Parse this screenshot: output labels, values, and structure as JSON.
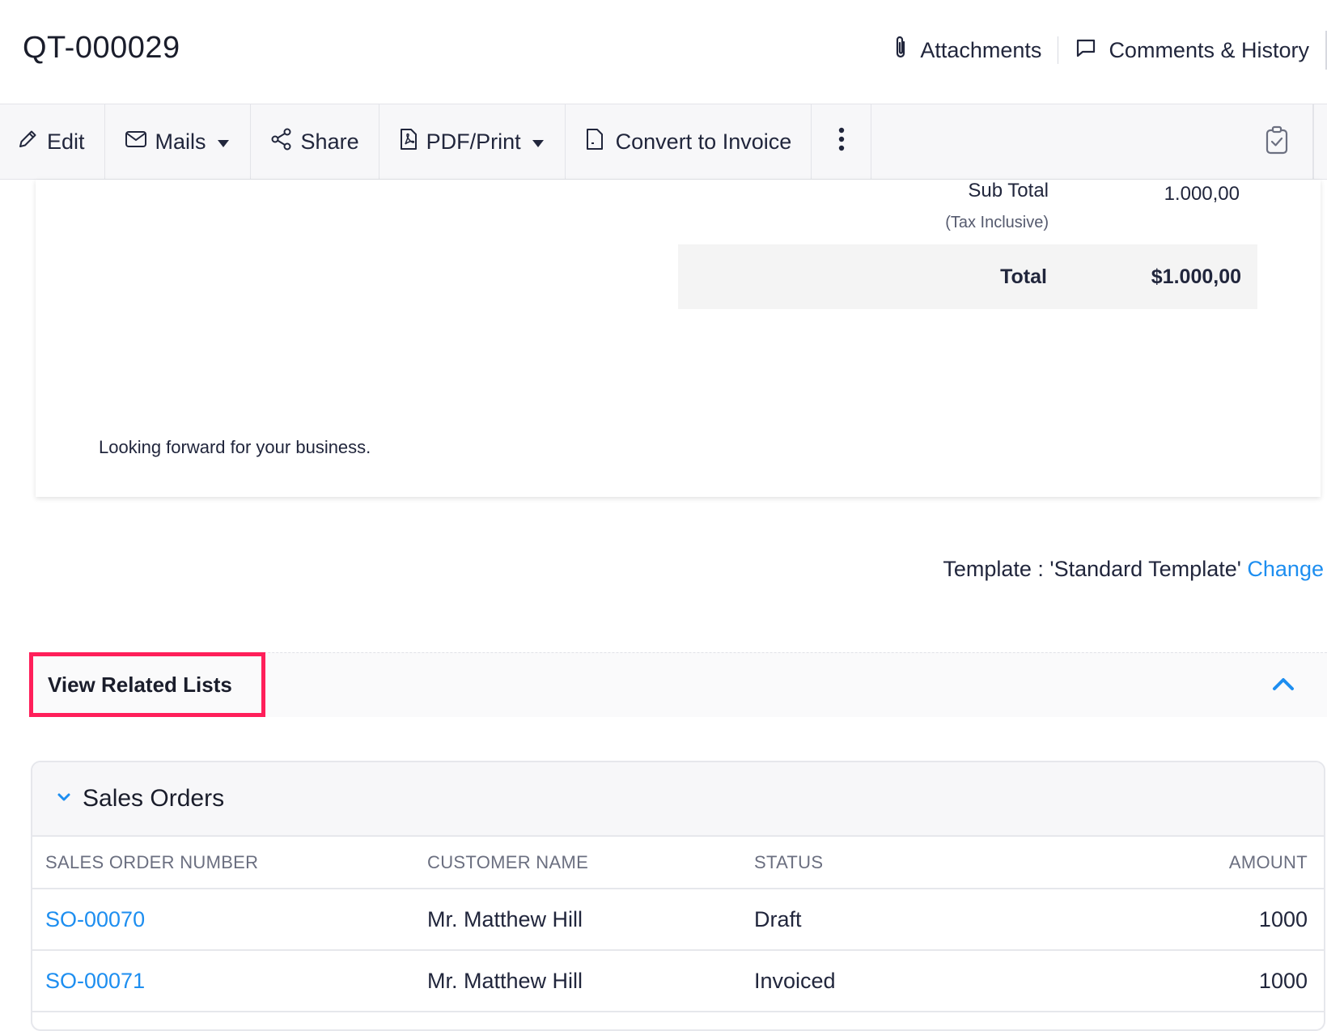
{
  "header": {
    "title": "QT-000029",
    "attachments_label": "Attachments",
    "comments_label": "Comments & History"
  },
  "toolbar": {
    "edit_label": "Edit",
    "mails_label": "Mails",
    "share_label": "Share",
    "pdf_label": "PDF/Print",
    "convert_label": "Convert to Invoice"
  },
  "document": {
    "subtotal_label": "Sub Total",
    "subtotal_value": "1.000,00",
    "tax_note": "(Tax Inclusive)",
    "total_label": "Total",
    "total_value": "$1.000,00",
    "notes": "Looking forward for your business."
  },
  "template": {
    "text": "Template : 'Standard Template'",
    "change_label": "Change"
  },
  "related": {
    "title": "View Related Lists"
  },
  "sales_orders": {
    "title": "Sales Orders",
    "columns": [
      "SALES ORDER NUMBER",
      "CUSTOMER NAME",
      "STATUS",
      "AMOUNT"
    ],
    "rows": [
      {
        "number": "SO-00070",
        "customer": "Mr. Matthew Hill",
        "status": "Draft",
        "amount": "1000"
      },
      {
        "number": "SO-00071",
        "customer": "Mr. Matthew Hill",
        "status": "Invoiced",
        "amount": "1000"
      }
    ]
  },
  "colors": {
    "link": "#1d8ef0",
    "highlight": "#ff1f5a",
    "toolbar_bg": "#f7f7f9"
  },
  "icons": [
    "paperclip-icon",
    "comment-icon",
    "pencil-icon",
    "mail-icon",
    "share-icon",
    "pdf-icon",
    "document-icon",
    "more-icon",
    "clipboard-check-icon",
    "chevron-up-icon",
    "chevron-down-icon"
  ]
}
